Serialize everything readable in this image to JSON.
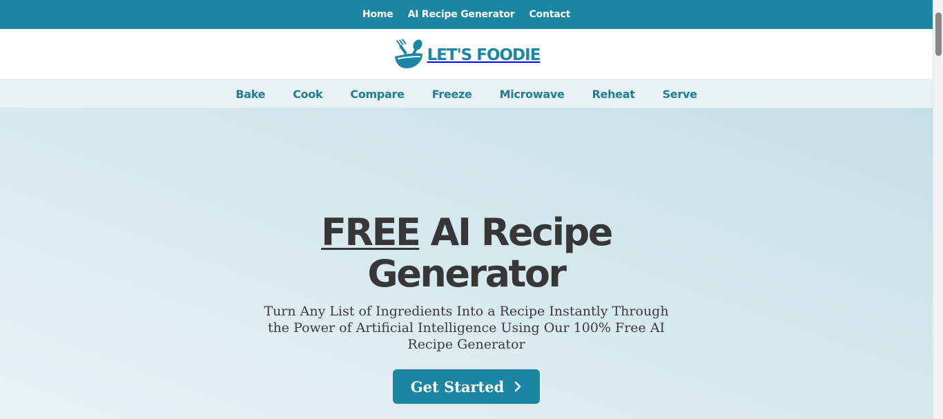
{
  "topnav": {
    "items": [
      "Home",
      "AI Recipe Generator",
      "Contact"
    ]
  },
  "logo": {
    "text": "LET'S FOODIE",
    "icon": "bowl-fork-spoon-icon"
  },
  "catnav": {
    "items": [
      "Bake",
      "Cook",
      "Compare",
      "Freeze",
      "Microwave",
      "Reheat",
      "Serve"
    ]
  },
  "hero": {
    "title_highlight": "FREE",
    "title_line1_rest": " AI Recipe",
    "title_line2": "Generator",
    "subtitle": "Turn Any List of Ingredients Into a Recipe Instantly Through the Power of Artificial Intelligence Using Our 100% Free AI Recipe Generator",
    "cta_label": "Get Started",
    "cta_icon": "chevron-right-icon"
  },
  "colors": {
    "brand": "#1b86a2",
    "hero_text": "#373737",
    "nav_bg": "#ebf2f5"
  }
}
